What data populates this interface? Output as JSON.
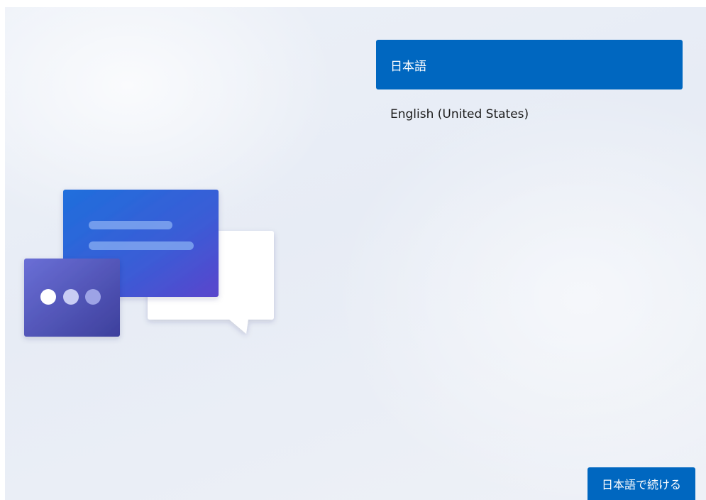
{
  "colors": {
    "accent": "#0067c0",
    "selected_text": "#ffffff"
  },
  "language_list": {
    "items": [
      {
        "label": "日本語",
        "selected": true
      },
      {
        "label": "English (United States)",
        "selected": false
      }
    ]
  },
  "illustration": {
    "icon": "chat-bubbles-illustration"
  },
  "footer": {
    "continue_label": "日本語で続ける"
  }
}
